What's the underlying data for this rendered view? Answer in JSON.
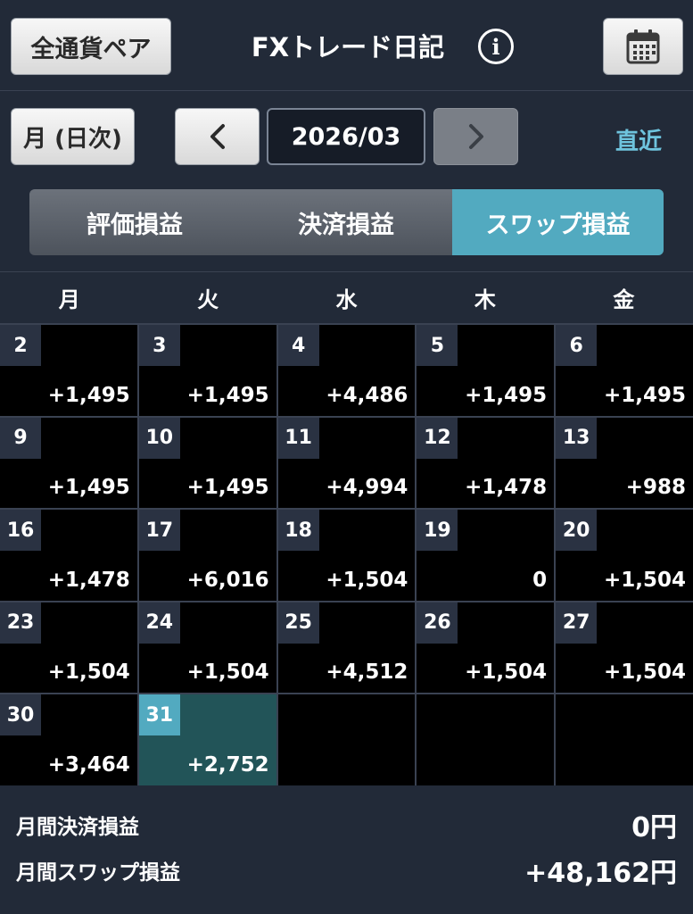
{
  "header": {
    "currency_button": "全通貨ペア",
    "title": "FXトレード日記",
    "info_icon": "info-icon",
    "calendar_icon": "calendar-icon"
  },
  "controls": {
    "period_button": "月 (日次)",
    "prev_icon": "chevron-left-icon",
    "month": "2026/03",
    "next_icon": "chevron-right-icon",
    "recent_link": "直近"
  },
  "tabs": [
    {
      "label": "評価損益",
      "active": false
    },
    {
      "label": "決済損益",
      "active": false
    },
    {
      "label": "スワップ損益",
      "active": true
    }
  ],
  "weekdays": [
    "月",
    "火",
    "水",
    "木",
    "金"
  ],
  "calendar": [
    {
      "day": "2",
      "value": "+1,495"
    },
    {
      "day": "3",
      "value": "+1,495"
    },
    {
      "day": "4",
      "value": "+4,486"
    },
    {
      "day": "5",
      "value": "+1,495"
    },
    {
      "day": "6",
      "value": "+1,495"
    },
    {
      "day": "9",
      "value": "+1,495"
    },
    {
      "day": "10",
      "value": "+1,495"
    },
    {
      "day": "11",
      "value": "+4,994"
    },
    {
      "day": "12",
      "value": "+1,478"
    },
    {
      "day": "13",
      "value": "+988"
    },
    {
      "day": "16",
      "value": "+1,478"
    },
    {
      "day": "17",
      "value": "+6,016"
    },
    {
      "day": "18",
      "value": "+1,504"
    },
    {
      "day": "19",
      "value": "0"
    },
    {
      "day": "20",
      "value": "+1,504"
    },
    {
      "day": "23",
      "value": "+1,504"
    },
    {
      "day": "24",
      "value": "+1,504"
    },
    {
      "day": "25",
      "value": "+4,512"
    },
    {
      "day": "26",
      "value": "+1,504"
    },
    {
      "day": "27",
      "value": "+1,504"
    },
    {
      "day": "30",
      "value": "+3,464"
    },
    {
      "day": "31",
      "value": "+2,752",
      "today": true
    },
    {
      "day": "",
      "value": ""
    },
    {
      "day": "",
      "value": ""
    },
    {
      "day": "",
      "value": ""
    }
  ],
  "summary": {
    "settled_label": "月間決済損益",
    "settled_value": "0円",
    "swap_label": "月間スワップ損益",
    "swap_value": "+48,162円"
  },
  "colors": {
    "background": "#222a38",
    "accent": "#52aac0",
    "today_cell": "#225458",
    "link": "#6ec3dd"
  }
}
